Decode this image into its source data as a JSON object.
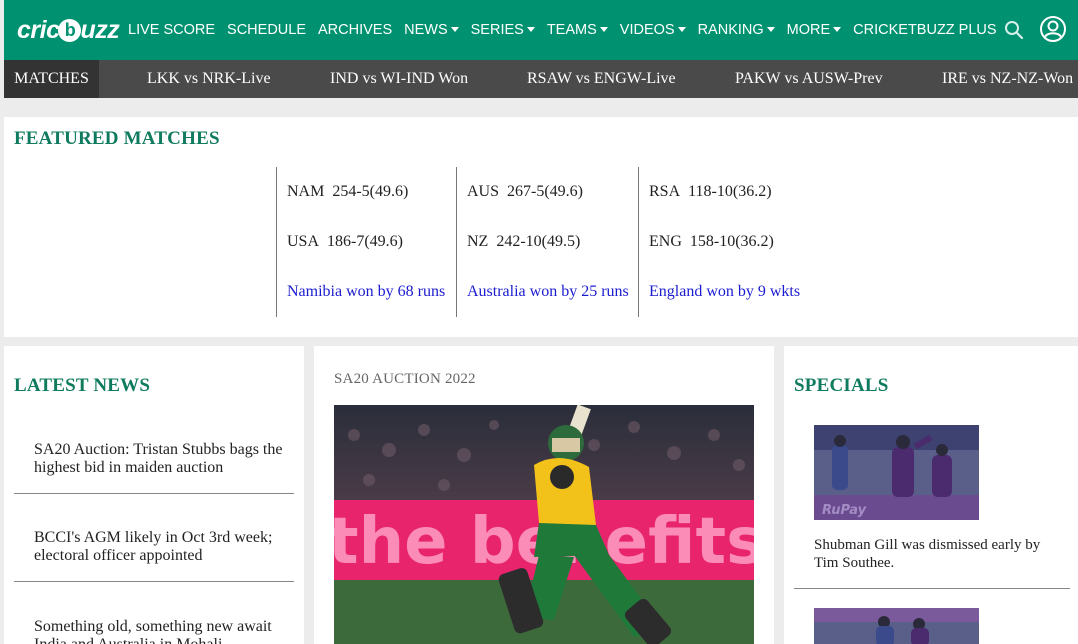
{
  "brand": {
    "logo_text_pre": "cric",
    "logo_ball": "b",
    "logo_text_post": "uzz"
  },
  "nav": [
    {
      "label": "LIVE SCORE",
      "dropdown": false
    },
    {
      "label": "SCHEDULE",
      "dropdown": false
    },
    {
      "label": "ARCHIVES",
      "dropdown": false
    },
    {
      "label": "NEWS",
      "dropdown": true
    },
    {
      "label": "SERIES",
      "dropdown": true
    },
    {
      "label": "TEAMS",
      "dropdown": true
    },
    {
      "label": "VIDEOS",
      "dropdown": true
    },
    {
      "label": "RANKING",
      "dropdown": true
    },
    {
      "label": "MORE",
      "dropdown": true
    },
    {
      "label": "CRICKETBUZZ PLUS",
      "dropdown": false
    }
  ],
  "matches_bar": {
    "label": "MATCHES",
    "items": [
      "LKK vs NRK-Live",
      "IND vs WI-IND Won",
      "RSAW vs ENGW-Live",
      "PAKW vs AUSW-Prev",
      "IRE vs NZ-NZ-Won"
    ]
  },
  "featured": {
    "title": "FEATURED MATCHES",
    "matches": [
      {
        "team1": "NAM",
        "score1": "254-5(49.6)",
        "team2": "USA",
        "score2": "186-7(49.6)",
        "result": "Namibia won by 68 runs"
      },
      {
        "team1": "AUS",
        "score1": "267-5(49.6)",
        "team2": "NZ",
        "score2": "242-10(49.5)",
        "result": "Australia won by 25 runs"
      },
      {
        "team1": "RSA",
        "score1": "118-10(36.2)",
        "team2": "ENG",
        "score2": "158-10(36.2)",
        "result": "England won by 9 wkts"
      }
    ]
  },
  "latest_news": {
    "title": "LATEST NEWS",
    "items": [
      "SA20 Auction: Tristan Stubbs bags the highest bid in maiden auction",
      "BCCI's AGM likely in Oct 3rd week; electoral officer appointed",
      "Something old, something new await India and Australia in Mohali"
    ]
  },
  "feature_story": {
    "kicker": "SA20 AUCTION 2022",
    "image_banner_text": "the benefits of"
  },
  "specials": {
    "title": "SPECIALS",
    "items": [
      {
        "caption": "Shubman Gill was dismissed early by Tim Southee.",
        "image_text": "RuPay"
      }
    ]
  },
  "colors": {
    "brand_green": "#009270",
    "title_green": "#0f7b5e",
    "link_blue": "#1b1bd0",
    "strip_grey": "#4a4a4a"
  },
  "icons": {
    "search": "search-icon",
    "account": "user-account-icon"
  }
}
